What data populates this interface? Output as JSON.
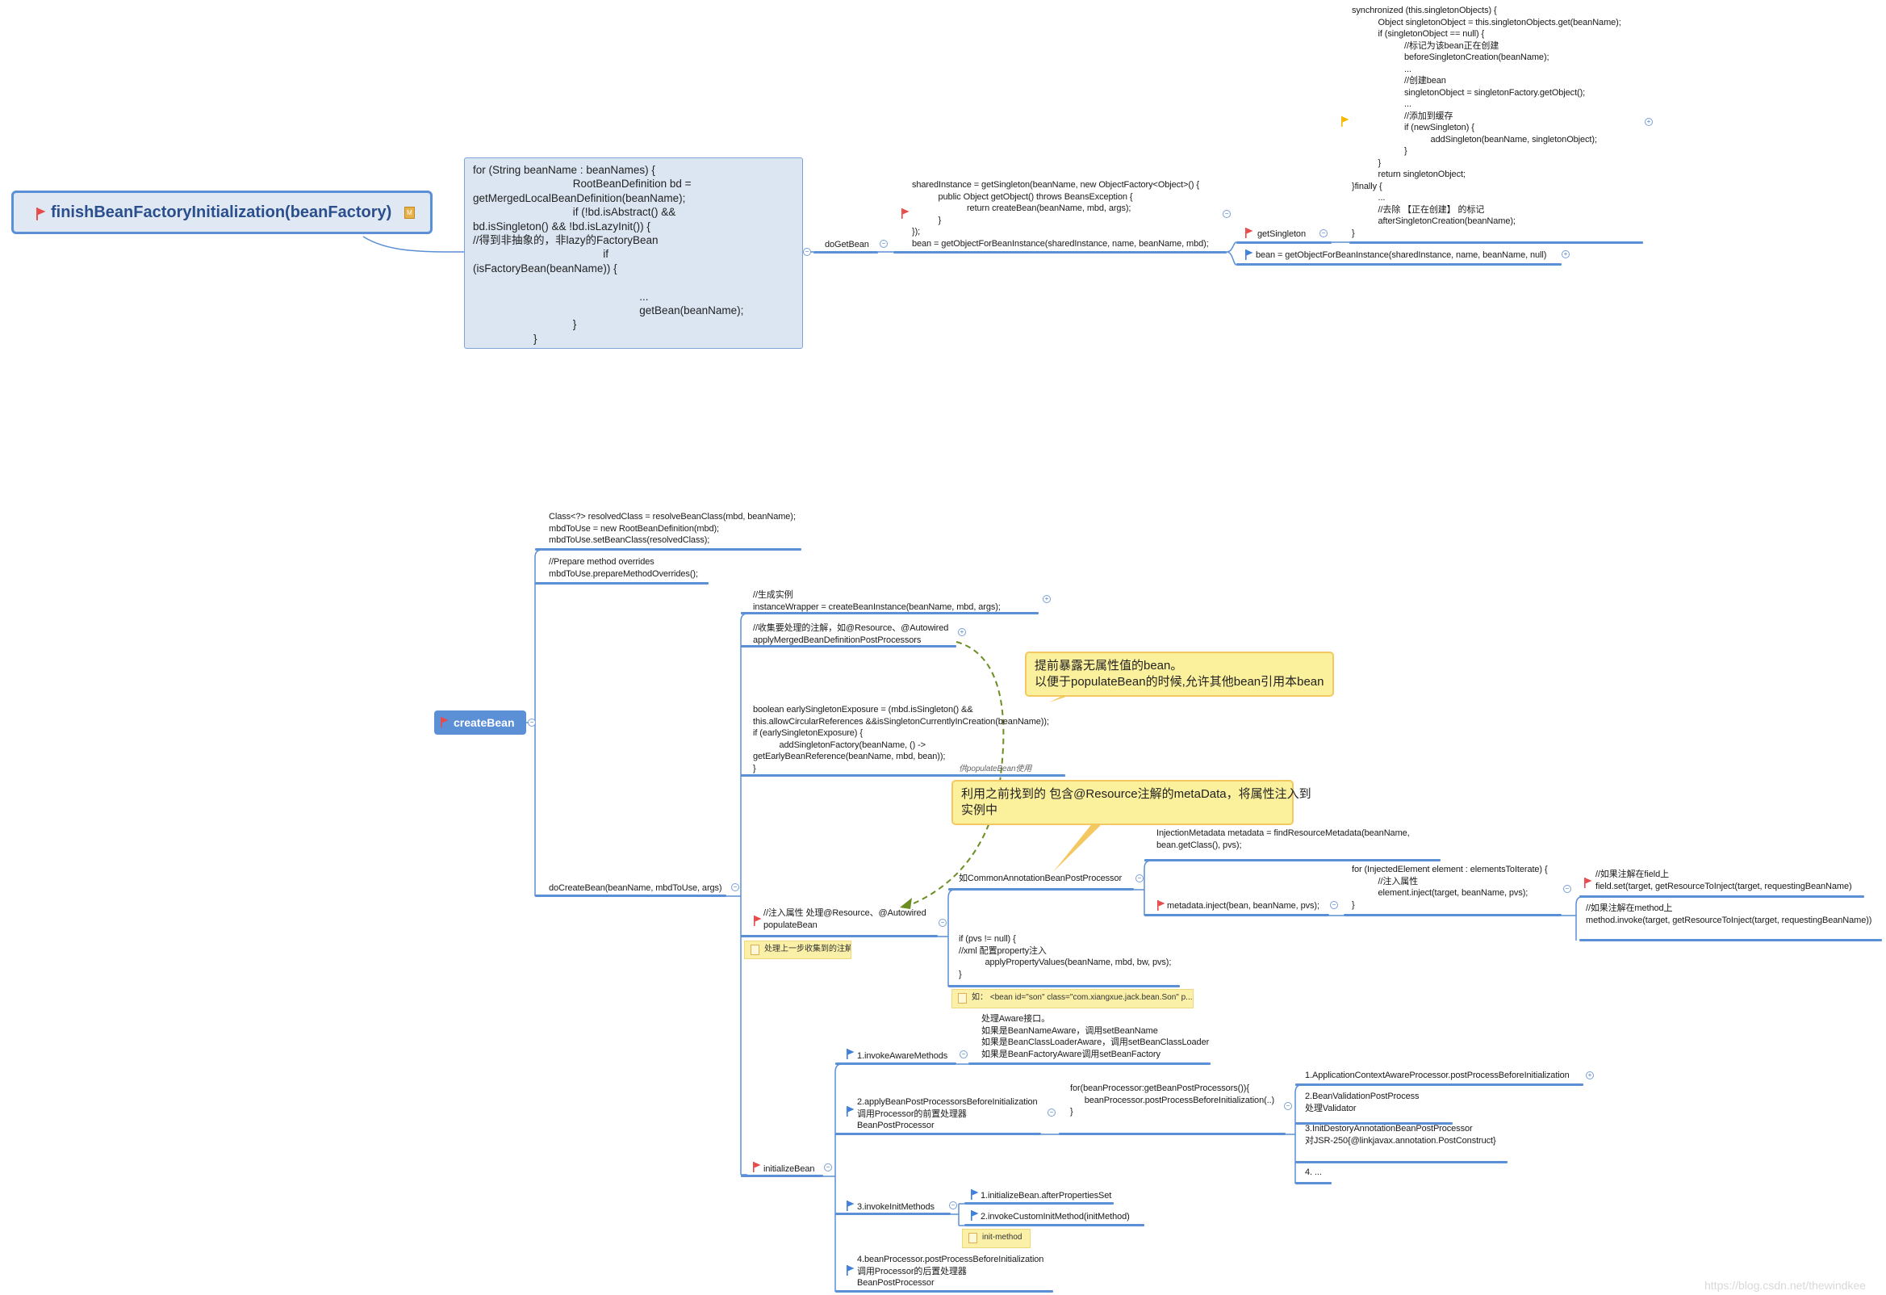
{
  "colors": {
    "accent": "#5b8fd6",
    "flag_red": "#e84a4a",
    "flag_blue": "#3e7fd9",
    "flag_yellow": "#f5b800",
    "callout": "#fbf09c",
    "connector_dashed": "#6b8e23"
  },
  "root": {
    "label": "finishBeanFactoryInitialization(beanFactory)",
    "marker": "M"
  },
  "for_loop_box": {
    "code": "for (String beanName : beanNames) {\n                                 RootBeanDefinition bd =\ngetMergedLocalBeanDefinition(beanName);\n                                 if (!bd.isAbstract() &&\nbd.isSingleton() && !bd.isLazyInit()) {\n//得到非抽象的，非lazy的FactoryBean\n                                           if\n(isFactoryBean(beanName)) {\n\n                                                       ...\n                                                       getBean(beanName);\n                                 }\n                    }"
  },
  "doGetBean": {
    "label": "doGetBean",
    "shared_instance_code": "sharedInstance = getSingleton(beanName, new ObjectFactory<Object>() {\n           public Object getObject() throws BeansException {\n                       return createBean(beanName, mbd, args);\n           }\n});\nbean = getObjectForBeanInstance(sharedInstance, name, beanName, mbd);",
    "getSingleton": {
      "label": "getSingleton",
      "code": "synchronized (this.singletonObjects) {\n           Object singletonObject = this.singletonObjects.get(beanName);\n           if (singletonObject == null) {\n                      //标记为该bean正在创建\n                      beforeSingletonCreation(beanName);\n                      ...\n                      //创建bean\n                      singletonObject = singletonFactory.getObject();\n                      ...\n                      //添加到缓存\n                      if (newSingleton) {\n                                 addSingleton(beanName, singletonObject);\n                      }\n           }\n           return singletonObject;\n}finally {\n           ...\n           //去除 【正在创建】 的标记\n           afterSingletonCreation(beanName);\n}"
    },
    "get_object_null": "bean = getObjectForBeanInstance(sharedInstance, name, beanName, null)"
  },
  "createBean": {
    "label": "createBean",
    "resolve_code": "Class<?> resolvedClass = resolveBeanClass(mbd, beanName);\nmbdToUse = new RootBeanDefinition(mbd);\nmbdToUse.setBeanClass(resolvedClass);",
    "prepare_code": "//Prepare method overrides\nmbdToUse.prepareMethodOverrides();",
    "doCreateBean": {
      "label": "doCreateBean(beanName, mbdToUse, args)",
      "create_instance": "//生成实例\ninstanceWrapper = createBeanInstance(beanName, mbd, args);",
      "collect_annotations": "//收集要处理的注解，如@Resource、@Autowired\napplyMergedBeanDefinitionPostProcessors",
      "early_exposure": "boolean earlySingletonExposure = (mbd.isSingleton() &&\nthis.allowCircularReferences &&isSingletonCurrentlyInCreation(beanName));\nif (earlySingletonExposure) {\n           addSingletonFactory(beanName, () ->\ngetEarlyBeanReference(beanName, mbd, bean));\n}",
      "early_exposure_label": "供populateBean使用",
      "populateBean": {
        "label": "//注入属性 处理@Resource、@Autowired\npopulateBean",
        "note": "处理上一步收集到的注解",
        "common_processor": "如CommonAnnotationBeanPostProcessor",
        "find_metadata": "InjectionMetadata metadata = findResourceMetadata(beanName,\nbean.getClass(), pvs);",
        "metadata_inject": "metadata.inject(bean, beanName, pvs);",
        "for_elements": "for (InjectedElement element : elementsToIterate) {\n           //注入属性\n           element.inject(target, beanName, pvs);\n}",
        "field_inject": "//如果注解在field上\nfield.set(target, getResourceToInject(target, requestingBeanName)",
        "method_inject": "//如果注解在method上\nmethod.invoke(target, getResourceToInject(target, requestingBeanName))",
        "xml_pvs": "if (pvs != null) {\n//xml 配置property注入\n           applyPropertyValues(beanName, mbd, bw, pvs);\n}",
        "xml_note": "如： <bean id=\"son\" class=\"com.xiangxue.jack.bean.Son\" p..."
      },
      "initializeBean": {
        "label": "initializeBean",
        "aware_label": "1.invokeAwareMethods",
        "aware_desc": "处理Aware接口。\n如果是BeanNameAware，调用setBeanName\n如果是BeanClassLoaderAware，调用setBeanClassLoader\n如果是BeanFactoryAware调用setBeanFactory",
        "before_label": "2.applyBeanPostProcessorsBeforeInitialization\n调用Processor的前置处理器\nBeanPostProcessor",
        "before_loop": "for(beanProcessor:getBeanPostProcessors()){\n      beanProcessor.postProcessBeforeInitialization(..)\n}",
        "processors": [
          "1.ApplicationContextAwareProcessor.postProcessBeforeInitialization",
          "2.BeanValidationPostProcess\n处理Validator",
          "3.InitDestoryAnnotationBeanPostProcessor\n对JSR-250{@linkjavax.annotation.PostConstruct}",
          "4. ..."
        ],
        "init_label": "3.invokeInitMethods",
        "init_children": [
          "1.initializeBean.afterPropertiesSet",
          "2.invokeCustomInitMethod(initMethod)"
        ],
        "init_note": "init-method",
        "after_label": "4.beanProcessor.postProcessBeforeInitialization\n调用Processor的后置处理器\nBeanPostProcessor"
      }
    }
  },
  "callouts": {
    "early_expose": "提前暴露无属性值的bean。\n以便于populateBean的时候,允许其他bean引用本bean",
    "metadata_inject": "利用之前找到的 包含@Resource注解的metaData，将属性注入到\n实例中"
  },
  "watermark": "https://blog.csdn.net/thewindkee"
}
